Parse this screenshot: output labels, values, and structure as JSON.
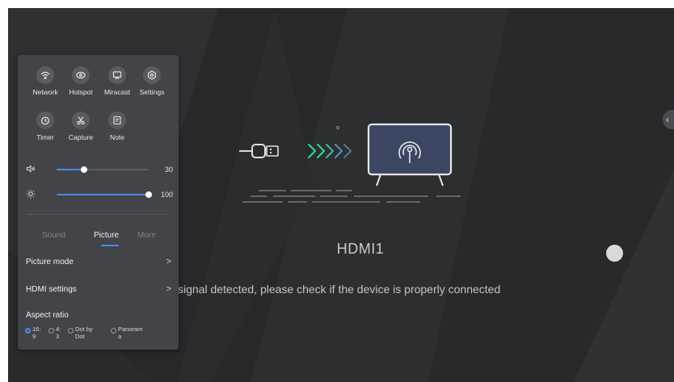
{
  "screen": {
    "source_title": "HDMI1",
    "no_signal_message": "signal detected, please check if the device is properly connected"
  },
  "panel": {
    "quick_row1": [
      {
        "label": "Network",
        "icon": "wifi-icon"
      },
      {
        "label": "Hotspot",
        "icon": "hotspot-icon"
      },
      {
        "label": "Miracast",
        "icon": "cast-icon"
      },
      {
        "label": "Settings",
        "icon": "gear-icon"
      }
    ],
    "quick_row2": [
      {
        "label": "Timer",
        "icon": "timer-icon"
      },
      {
        "label": "Capture",
        "icon": "scissors-icon"
      },
      {
        "label": "Note",
        "icon": "note-icon"
      }
    ],
    "volume": {
      "value": "30",
      "level": 0.3
    },
    "brightness": {
      "value": "100",
      "level": 1.0
    },
    "tabs": [
      "Sound",
      "Picture",
      "More"
    ],
    "active_tab": "Picture",
    "rows": [
      {
        "label": "Picture mode",
        "chevron": ">"
      },
      {
        "label": "HDMI settings",
        "chevron": ">"
      }
    ],
    "aspect_ratio": {
      "label": "Aspect ratio",
      "options": [
        {
          "line1": "16:",
          "line2": "9",
          "selected": true
        },
        {
          "line1": "4:",
          "line2": "3",
          "selected": false
        },
        {
          "line1": "Dot by",
          "line2": "Dot",
          "selected": false
        },
        {
          "line1": "Panoram",
          "line2": "a",
          "selected": false
        }
      ]
    }
  },
  "edge_tab": {
    "glyph": "‹"
  },
  "colors": {
    "accent": "#4e86ea",
    "panel_bg": "#424447",
    "screen_bg": "#2b2c2e"
  }
}
